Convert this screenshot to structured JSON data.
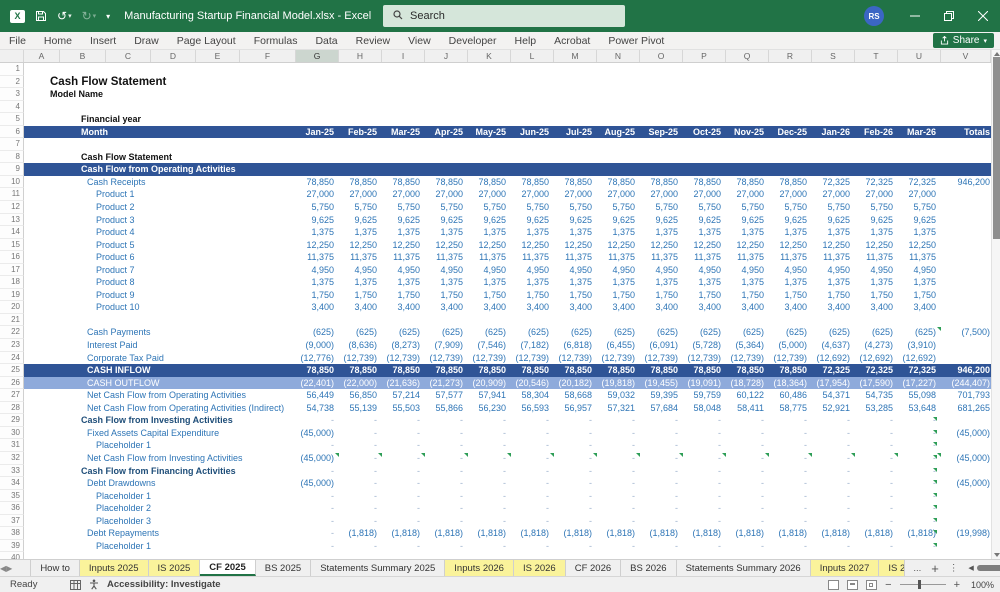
{
  "colors": {
    "accent_green": "#217346",
    "header_blue": "#2F5496",
    "outflow_blue": "#8EAADB",
    "label_blue": "#2E75B6",
    "section_navy": "#1F4E79",
    "tab_yellow": "#FAF39B",
    "flag_green": "#2E9E57"
  },
  "titlebar": {
    "title": "Manufacturing Startup Financial Model.xlsx - Excel",
    "search_placeholder": "Search",
    "avatar_initials": "RS"
  },
  "menubar": {
    "items": [
      "File",
      "Home",
      "Insert",
      "Draw",
      "Page Layout",
      "Formulas",
      "Data",
      "Review",
      "View",
      "Developer",
      "Help",
      "Acrobat",
      "Power Pivot"
    ],
    "share_label": "Share"
  },
  "columns": {
    "letters": [
      "A",
      "B",
      "C",
      "D",
      "E",
      "F",
      "G",
      "H",
      "I",
      "J",
      "K",
      "L",
      "M",
      "N",
      "O",
      "P",
      "Q",
      "R",
      "S",
      "T",
      "U",
      "V"
    ],
    "selected": "G"
  },
  "sheet": {
    "month_label": "Month",
    "totals_label": "Totals",
    "months": [
      "Jan-25",
      "Feb-25",
      "Mar-25",
      "Apr-25",
      "May-25",
      "Jun-25",
      "Jul-25",
      "Aug-25",
      "Sep-25",
      "Oct-25",
      "Nov-25",
      "Dec-25",
      "Jan-26",
      "Feb-26",
      "Mar-26"
    ],
    "rows": [
      {
        "n": 1,
        "style": "empty"
      },
      {
        "n": 2,
        "style": "title",
        "label": "Cash Flow Statement"
      },
      {
        "n": 3,
        "style": "black",
        "label": "Model Name"
      },
      {
        "n": 4,
        "style": "empty"
      },
      {
        "n": 5,
        "style": "boldlbl",
        "label": "Financial year"
      },
      {
        "n": 6,
        "style": "monthhdr"
      },
      {
        "n": 7,
        "style": "empty"
      },
      {
        "n": 8,
        "style": "boldlbl",
        "label": "Cash Flow Statement"
      },
      {
        "n": 9,
        "style": "dark",
        "label": "Cash Flow from Operating Activities"
      },
      {
        "n": 10,
        "style": "item",
        "label": "Cash Receipts",
        "cells": [
          "78,850",
          "78,850",
          "78,850",
          "78,850",
          "78,850",
          "78,850",
          "78,850",
          "78,850",
          "78,850",
          "78,850",
          "78,850",
          "78,850",
          "72,325",
          "72,325",
          "72,325"
        ],
        "total": "946,200"
      },
      {
        "n": 11,
        "style": "item2",
        "label": "Product 1",
        "cells": [
          "27,000",
          "27,000",
          "27,000",
          "27,000",
          "27,000",
          "27,000",
          "27,000",
          "27,000",
          "27,000",
          "27,000",
          "27,000",
          "27,000",
          "27,000",
          "27,000",
          "27,000"
        ]
      },
      {
        "n": 12,
        "style": "item2",
        "label": "Product 2",
        "cells": [
          "5,750",
          "5,750",
          "5,750",
          "5,750",
          "5,750",
          "5,750",
          "5,750",
          "5,750",
          "5,750",
          "5,750",
          "5,750",
          "5,750",
          "5,750",
          "5,750",
          "5,750"
        ]
      },
      {
        "n": 13,
        "style": "item2",
        "label": "Product 3",
        "cells": [
          "9,625",
          "9,625",
          "9,625",
          "9,625",
          "9,625",
          "9,625",
          "9,625",
          "9,625",
          "9,625",
          "9,625",
          "9,625",
          "9,625",
          "9,625",
          "9,625",
          "9,625"
        ]
      },
      {
        "n": 14,
        "style": "item2",
        "label": "Product 4",
        "cells": [
          "1,375",
          "1,375",
          "1,375",
          "1,375",
          "1,375",
          "1,375",
          "1,375",
          "1,375",
          "1,375",
          "1,375",
          "1,375",
          "1,375",
          "1,375",
          "1,375",
          "1,375"
        ]
      },
      {
        "n": 15,
        "style": "item2",
        "label": "Product 5",
        "cells": [
          "12,250",
          "12,250",
          "12,250",
          "12,250",
          "12,250",
          "12,250",
          "12,250",
          "12,250",
          "12,250",
          "12,250",
          "12,250",
          "12,250",
          "12,250",
          "12,250",
          "12,250"
        ]
      },
      {
        "n": 16,
        "style": "item2",
        "label": "Product 6",
        "cells": [
          "11,375",
          "11,375",
          "11,375",
          "11,375",
          "11,375",
          "11,375",
          "11,375",
          "11,375",
          "11,375",
          "11,375",
          "11,375",
          "11,375",
          "11,375",
          "11,375",
          "11,375"
        ]
      },
      {
        "n": 17,
        "style": "item2",
        "label": "Product 7",
        "cells": [
          "4,950",
          "4,950",
          "4,950",
          "4,950",
          "4,950",
          "4,950",
          "4,950",
          "4,950",
          "4,950",
          "4,950",
          "4,950",
          "4,950",
          "4,950",
          "4,950",
          "4,950"
        ]
      },
      {
        "n": 18,
        "style": "item2",
        "label": "Product 8",
        "cells": [
          "1,375",
          "1,375",
          "1,375",
          "1,375",
          "1,375",
          "1,375",
          "1,375",
          "1,375",
          "1,375",
          "1,375",
          "1,375",
          "1,375",
          "1,375",
          "1,375",
          "1,375"
        ]
      },
      {
        "n": 19,
        "style": "item2",
        "label": "Product 9",
        "cells": [
          "1,750",
          "1,750",
          "1,750",
          "1,750",
          "1,750",
          "1,750",
          "1,750",
          "1,750",
          "1,750",
          "1,750",
          "1,750",
          "1,750",
          "1,750",
          "1,750",
          "1,750"
        ]
      },
      {
        "n": 20,
        "style": "item2",
        "label": "Product 10",
        "cells": [
          "3,400",
          "3,400",
          "3,400",
          "3,400",
          "3,400",
          "3,400",
          "3,400",
          "3,400",
          "3,400",
          "3,400",
          "3,400",
          "3,400",
          "3,400",
          "3,400",
          "3,400"
        ]
      },
      {
        "n": 21,
        "style": "empty"
      },
      {
        "n": 22,
        "style": "item",
        "label": "Cash Payments",
        "cells": [
          "(625)",
          "(625)",
          "(625)",
          "(625)",
          "(625)",
          "(625)",
          "(625)",
          "(625)",
          "(625)",
          "(625)",
          "(625)",
          "(625)",
          "(625)",
          "(625)",
          "(625)"
        ],
        "total": "(7,500)",
        "flags": [
          14
        ]
      },
      {
        "n": 23,
        "style": "item",
        "label": "Interest Paid",
        "cells": [
          "(9,000)",
          "(8,636)",
          "(8,273)",
          "(7,909)",
          "(7,546)",
          "(7,182)",
          "(6,818)",
          "(6,455)",
          "(6,091)",
          "(5,728)",
          "(5,364)",
          "(5,000)",
          "(4,637)",
          "(4,273)",
          "(3,910)"
        ]
      },
      {
        "n": 24,
        "style": "item",
        "label": "Corporate Tax Paid",
        "cells": [
          "(12,776)",
          "(12,739)",
          "(12,739)",
          "(12,739)",
          "(12,739)",
          "(12,739)",
          "(12,739)",
          "(12,739)",
          "(12,739)",
          "(12,739)",
          "(12,739)",
          "(12,739)",
          "(12,692)",
          "(12,692)",
          "(12,692)"
        ]
      },
      {
        "n": 25,
        "style": "darkrow",
        "label": "CASH INFLOW",
        "cells": [
          "78,850",
          "78,850",
          "78,850",
          "78,850",
          "78,850",
          "78,850",
          "78,850",
          "78,850",
          "78,850",
          "78,850",
          "78,850",
          "78,850",
          "72,325",
          "72,325",
          "72,325"
        ],
        "total": "946,200"
      },
      {
        "n": 26,
        "style": "outflow",
        "label": "CASH OUTFLOW",
        "cells": [
          "(22,401)",
          "(22,000)",
          "(21,636)",
          "(21,273)",
          "(20,909)",
          "(20,546)",
          "(20,182)",
          "(19,818)",
          "(19,455)",
          "(19,091)",
          "(18,728)",
          "(18,364)",
          "(17,954)",
          "(17,590)",
          "(17,227)"
        ],
        "total": "(244,407)"
      },
      {
        "n": 27,
        "style": "item",
        "label": "Net Cash Flow from Operating Activities",
        "cells": [
          "56,449",
          "56,850",
          "57,214",
          "57,577",
          "57,941",
          "58,304",
          "58,668",
          "59,032",
          "59,395",
          "59,759",
          "60,122",
          "60,486",
          "54,371",
          "54,735",
          "55,098"
        ],
        "total": "701,793"
      },
      {
        "n": 28,
        "style": "item",
        "label": "Net Cash Flow from Operating Activities (Indirect)",
        "cells": [
          "54,738",
          "55,139",
          "55,503",
          "55,866",
          "56,230",
          "56,593",
          "56,957",
          "57,321",
          "57,684",
          "58,048",
          "58,411",
          "58,775",
          "52,921",
          "53,285",
          "53,648"
        ],
        "total": "681,265"
      },
      {
        "n": 29,
        "style": "section",
        "label": "Cash Flow from Investing Activities",
        "cells": [
          "-",
          "-",
          "-",
          "-",
          "-",
          "-",
          "-",
          "-",
          "-",
          "-",
          "-",
          "-",
          "-",
          "-",
          "-"
        ],
        "edge_flag": true
      },
      {
        "n": 30,
        "style": "item",
        "label": "Fixed Assets Capital Expenditure",
        "cells": [
          "(45,000)",
          "-",
          "-",
          "-",
          "-",
          "-",
          "-",
          "-",
          "-",
          "-",
          "-",
          "-",
          "-",
          "-",
          "-"
        ],
        "total": "(45,000)",
        "edge_flag": true
      },
      {
        "n": 31,
        "style": "item2",
        "label": "Placeholder 1",
        "cells": [
          "-",
          "-",
          "-",
          "-",
          "-",
          "-",
          "-",
          "-",
          "-",
          "-",
          "-",
          "-",
          "-",
          "-",
          "-"
        ],
        "edge_flag": true
      },
      {
        "n": 32,
        "style": "item",
        "label": "Net Cash Flow from Investing Activities",
        "cells": [
          "(45,000)",
          "-",
          "-",
          "-",
          "-",
          "-",
          "-",
          "-",
          "-",
          "-",
          "-",
          "-",
          "-",
          "-",
          "-"
        ],
        "total": "(45,000)",
        "flags": "all",
        "edge_flag": true
      },
      {
        "n": 33,
        "style": "section",
        "label": "Cash Flow from Financing Activities",
        "cells": [
          "-",
          "-",
          "-",
          "-",
          "-",
          "-",
          "-",
          "-",
          "-",
          "-",
          "-",
          "-",
          "-",
          "-",
          "-"
        ],
        "edge_flag": true
      },
      {
        "n": 34,
        "style": "item",
        "label": "Debt Drawdowns",
        "cells": [
          "(45,000)",
          "-",
          "-",
          "-",
          "-",
          "-",
          "-",
          "-",
          "-",
          "-",
          "-",
          "-",
          "-",
          "-",
          "-"
        ],
        "total": "(45,000)",
        "edge_flag": true
      },
      {
        "n": 35,
        "style": "item2",
        "label": "Placeholder 1",
        "cells": [
          "-",
          "-",
          "-",
          "-",
          "-",
          "-",
          "-",
          "-",
          "-",
          "-",
          "-",
          "-",
          "-",
          "-",
          "-"
        ],
        "edge_flag": true
      },
      {
        "n": 36,
        "style": "item2",
        "label": "Placeholder 2",
        "cells": [
          "-",
          "-",
          "-",
          "-",
          "-",
          "-",
          "-",
          "-",
          "-",
          "-",
          "-",
          "-",
          "-",
          "-",
          "-"
        ],
        "edge_flag": true
      },
      {
        "n": 37,
        "style": "item2",
        "label": "Placeholder 3",
        "cells": [
          "-",
          "-",
          "-",
          "-",
          "-",
          "-",
          "-",
          "-",
          "-",
          "-",
          "-",
          "-",
          "-",
          "-",
          "-"
        ],
        "edge_flag": true
      },
      {
        "n": 38,
        "style": "item",
        "label": "Debt Repayments",
        "cells": [
          "-",
          "(1,818)",
          "(1,818)",
          "(1,818)",
          "(1,818)",
          "(1,818)",
          "(1,818)",
          "(1,818)",
          "(1,818)",
          "(1,818)",
          "(1,818)",
          "(1,818)",
          "(1,818)",
          "(1,818)",
          "(1,818)"
        ],
        "total": "(19,998)",
        "edge_flag": true
      },
      {
        "n": 39,
        "style": "item2",
        "label": "Placeholder 1",
        "cells": [
          "-",
          "-",
          "-",
          "-",
          "-",
          "-",
          "-",
          "-",
          "-",
          "-",
          "-",
          "-",
          "-",
          "-",
          "-"
        ],
        "edge_flag": true
      },
      {
        "n": 40,
        "style": "empty"
      }
    ]
  },
  "tabs": {
    "items": [
      {
        "label": "How to",
        "type": "normal"
      },
      {
        "label": "Inputs 2025",
        "type": "yellow"
      },
      {
        "label": "IS 2025",
        "type": "yellow"
      },
      {
        "label": "CF 2025",
        "type": "active"
      },
      {
        "label": "BS 2025",
        "type": "normal"
      },
      {
        "label": "Statements Summary 2025",
        "type": "normal"
      },
      {
        "label": "Inputs 2026",
        "type": "yellow"
      },
      {
        "label": "IS 2026",
        "type": "yellow"
      },
      {
        "label": "CF 2026",
        "type": "normal"
      },
      {
        "label": "BS 2026",
        "type": "normal"
      },
      {
        "label": "Statements Summary 2026",
        "type": "normal"
      },
      {
        "label": "Inputs 2027",
        "type": "yellow"
      },
      {
        "label": "IS 2",
        "type": "yellow-clip"
      }
    ],
    "more_label": "...",
    "add_label": "+",
    "menu_label": "⋮"
  },
  "statusbar": {
    "ready": "Ready",
    "accessibility": "Accessibility: Investigate",
    "zoom": "100%"
  }
}
